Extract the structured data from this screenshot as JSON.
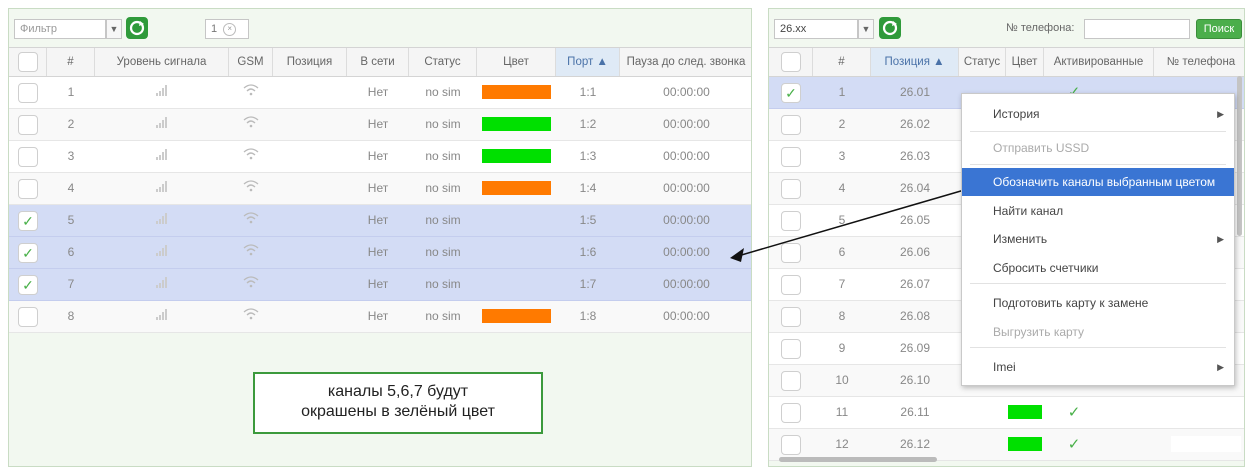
{
  "left": {
    "filter_placeholder": "Фильтр",
    "chip_value": "1",
    "chip_clear": "×",
    "columns": [
      "#",
      "Уровень сигнала",
      "GSM",
      "Позиция",
      "В сети",
      "Статус",
      "Цвет",
      "Порт ▲",
      "Пауза до след. звонка"
    ],
    "rows": [
      {
        "num": "1",
        "online": "Нет",
        "status": "no sim",
        "color": "#ff7a00",
        "port": "1:1",
        "pause": "00:00:00",
        "checked": false
      },
      {
        "num": "2",
        "online": "Нет",
        "status": "no sim",
        "color": "#00e000",
        "port": "1:2",
        "pause": "00:00:00",
        "checked": false
      },
      {
        "num": "3",
        "online": "Нет",
        "status": "no sim",
        "color": "#00e000",
        "port": "1:3",
        "pause": "00:00:00",
        "checked": false
      },
      {
        "num": "4",
        "online": "Нет",
        "status": "no sim",
        "color": "#ff7a00",
        "port": "1:4",
        "pause": "00:00:00",
        "checked": false
      },
      {
        "num": "5",
        "online": "Нет",
        "status": "no sim",
        "color": "",
        "port": "1:5",
        "pause": "00:00:00",
        "checked": true
      },
      {
        "num": "6",
        "online": "Нет",
        "status": "no sim",
        "color": "",
        "port": "1:6",
        "pause": "00:00:00",
        "checked": true
      },
      {
        "num": "7",
        "online": "Нет",
        "status": "no sim",
        "color": "",
        "port": "1:7",
        "pause": "00:00:00",
        "checked": true
      },
      {
        "num": "8",
        "online": "Нет",
        "status": "no sim",
        "color": "#ff7a00",
        "port": "1:8",
        "pause": "00:00:00",
        "checked": false
      }
    ]
  },
  "note": {
    "line1": "каналы 5,6,7 будут",
    "line2": "окрашены в зелёный цвет"
  },
  "right": {
    "filter_value": "26.xx",
    "phone_label": "№ телефона:",
    "phone_value": "",
    "search_label": "Поиск",
    "columns": [
      "#",
      "Позиция ▲",
      "Статус",
      "Цвет",
      "Активированные",
      "№ телефона"
    ],
    "rows": [
      {
        "num": "1",
        "pos": "26.01",
        "checked": true,
        "color": "",
        "activated": "✓"
      },
      {
        "num": "2",
        "pos": "26.02",
        "checked": false,
        "color": "",
        "activated": ""
      },
      {
        "num": "3",
        "pos": "26.03",
        "checked": false,
        "color": "",
        "activated": ""
      },
      {
        "num": "4",
        "pos": "26.04",
        "checked": false,
        "color": "",
        "activated": ""
      },
      {
        "num": "5",
        "pos": "26.05",
        "checked": false,
        "color": "",
        "activated": ""
      },
      {
        "num": "6",
        "pos": "26.06",
        "checked": false,
        "color": "",
        "activated": ""
      },
      {
        "num": "7",
        "pos": "26.07",
        "checked": false,
        "color": "",
        "activated": ""
      },
      {
        "num": "8",
        "pos": "26.08",
        "checked": false,
        "color": "",
        "activated": ""
      },
      {
        "num": "9",
        "pos": "26.09",
        "checked": false,
        "color": "",
        "activated": ""
      },
      {
        "num": "10",
        "pos": "26.10",
        "checked": false,
        "color": "",
        "activated": ""
      },
      {
        "num": "11",
        "pos": "26.11",
        "checked": false,
        "color": "#00e000",
        "activated": "✓"
      },
      {
        "num": "12",
        "pos": "26.12",
        "checked": false,
        "color": "#00e000",
        "activated": "✓"
      }
    ]
  },
  "context_menu": {
    "items": [
      {
        "label": "История",
        "submenu": true,
        "disabled": false,
        "highlighted": false
      },
      {
        "label": "Отправить USSD",
        "submenu": false,
        "disabled": true,
        "highlighted": false
      },
      {
        "label": "Обозначить каналы выбранным цветом",
        "submenu": false,
        "disabled": false,
        "highlighted": true
      },
      {
        "label": "Найти канал",
        "submenu": false,
        "disabled": false,
        "highlighted": false
      },
      {
        "label": "Изменить",
        "submenu": true,
        "disabled": false,
        "highlighted": false
      },
      {
        "label": "Сбросить счетчики",
        "submenu": false,
        "disabled": false,
        "highlighted": false
      },
      {
        "label": "Подготовить карту к замене",
        "submenu": false,
        "disabled": false,
        "highlighted": false
      },
      {
        "label": "Выгрузить карту",
        "submenu": false,
        "disabled": true,
        "highlighted": false
      },
      {
        "label": "Imei",
        "submenu": true,
        "disabled": false,
        "highlighted": false
      }
    ]
  },
  "colors": {
    "accent_green": "#4bae4b",
    "selection": "#d3dcf5",
    "menu_highlight": "#3a75d3",
    "orange": "#ff7a00",
    "green": "#00e000"
  }
}
